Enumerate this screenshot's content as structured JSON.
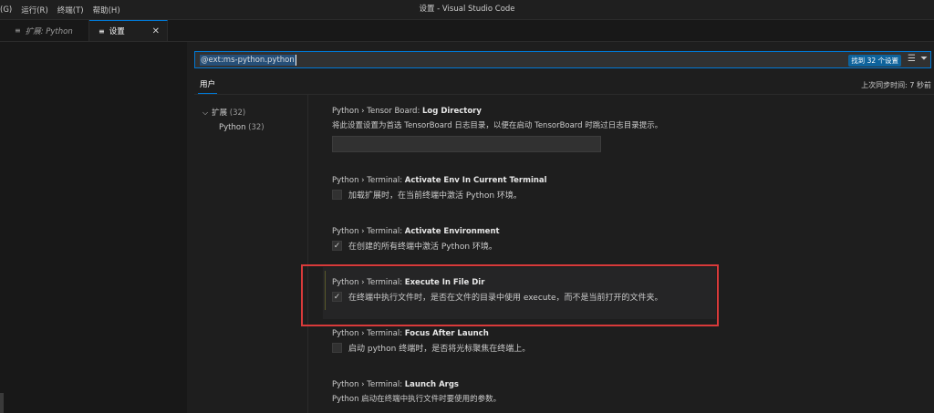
{
  "titlebar": {
    "menu": [
      "(G)",
      "运行(R)",
      "终端(T)",
      "帮助(H)"
    ],
    "window_title": "设置 - Visual Studio Code"
  },
  "tabs": [
    {
      "label": "扩展: Python",
      "icon": "preview-icon",
      "active": false
    },
    {
      "label": "设置",
      "icon": "settings-editor-icon",
      "active": true
    }
  ],
  "search": {
    "value": "@ext:ms-python.python",
    "result_count": "找到 32 个设置"
  },
  "scope": {
    "tab_label": "用户",
    "sync_status": "上次同步时间: 7 秒前"
  },
  "toc": {
    "group_label": "扩展",
    "group_count": "(32)",
    "sub_label": "Python",
    "sub_count": "(32)"
  },
  "settings": [
    {
      "category": "Python › Tensor Board: ",
      "name": "Log Directory",
      "description": "将此设置设置为首选 TensorBoard 日志目录，以便在启动 TensorBoard 时跳过日志目录提示。",
      "type": "text",
      "value": ""
    },
    {
      "category": "Python › Terminal: ",
      "name": "Activate Env In Current Terminal",
      "description": "加载扩展时，在当前终端中激活 Python 环境。",
      "type": "checkbox",
      "checked": false
    },
    {
      "category": "Python › Terminal: ",
      "name": "Activate Environment",
      "description": "在创建的所有终端中激活 Python 环境。",
      "type": "checkbox",
      "checked": true
    },
    {
      "category": "Python › Terminal: ",
      "name": "Execute In File Dir",
      "description": "在终端中执行文件时，是否在文件的目录中使用 execute，而不是当前打开的文件夹。",
      "type": "checkbox",
      "checked": true
    },
    {
      "category": "Python › Terminal: ",
      "name": "Focus After Launch",
      "description": "启动 python 终端时，是否将光标聚焦在终端上。",
      "type": "checkbox",
      "checked": false
    },
    {
      "category": "Python › Terminal: ",
      "name": "Launch Args",
      "description": "Python 启动在终端中执行文件时要使用的参数。",
      "type": "text-only"
    }
  ],
  "colors": {
    "accent": "#0078d4",
    "highlight_box": "#d93a3a",
    "background": "#1e1e1e"
  }
}
